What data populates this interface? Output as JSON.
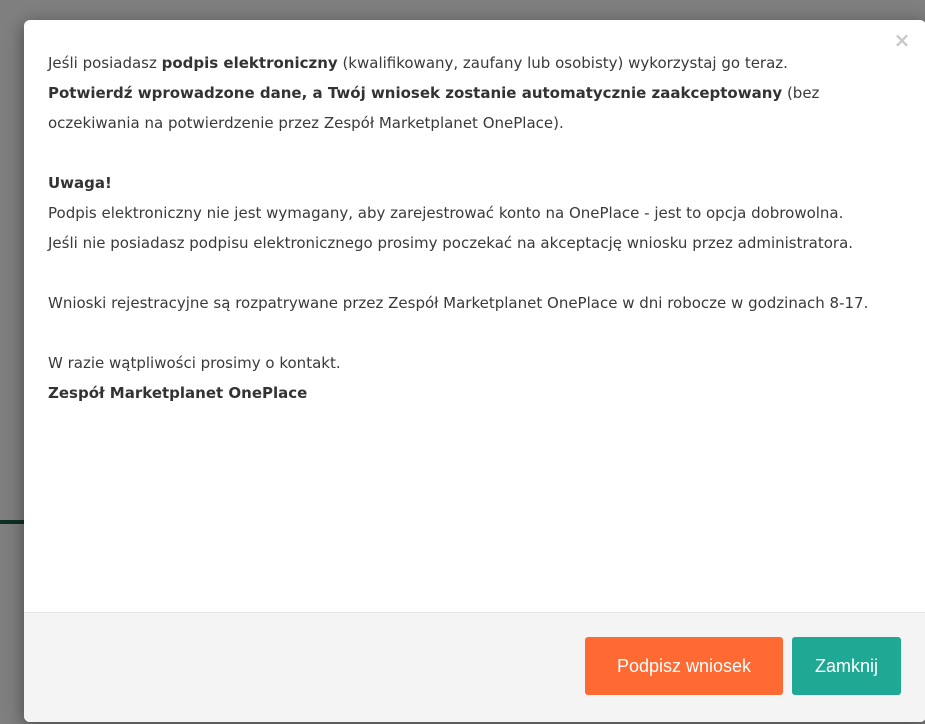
{
  "modal": {
    "close_symbol": "×",
    "intro": {
      "part1": "Jeśli posiadasz ",
      "bold1": "podpis elektroniczny",
      "part2": " (kwalifikowany, zaufany lub osobisty) wykorzystaj go teraz.",
      "bold2": "Potwierdź wprowadzone dane, a Twój wniosek zostanie automatycznie zaakceptowany",
      "part3": " (bez oczekiwania na potwierdzenie przez Zespół Marketplanet OnePlace)."
    },
    "warning_heading": "Uwaga!",
    "warning_line1": "Podpis elektroniczny nie jest wymagany, aby zarejestrować konto na OnePlace - jest to opcja dobrowolna.",
    "warning_line2": "Jeśli nie posiadasz podpisu elektronicznego prosimy poczekać na akceptację wniosku przez administratora.",
    "hours_text": "Wnioski rejestracyjne są rozpatrywane przez Zespół Marketplanet OnePlace w dni robocze w godzinach 8-17.",
    "contact_text": "W razie wątpliwości prosimy o kontakt.",
    "signature": "Zespół Marketplanet OnePlace",
    "buttons": {
      "sign_label": "Podpisz wniosek",
      "close_label": "Zamknij"
    },
    "colors": {
      "sign_button": "#ff6a32",
      "close_button": "#1fa894"
    }
  }
}
